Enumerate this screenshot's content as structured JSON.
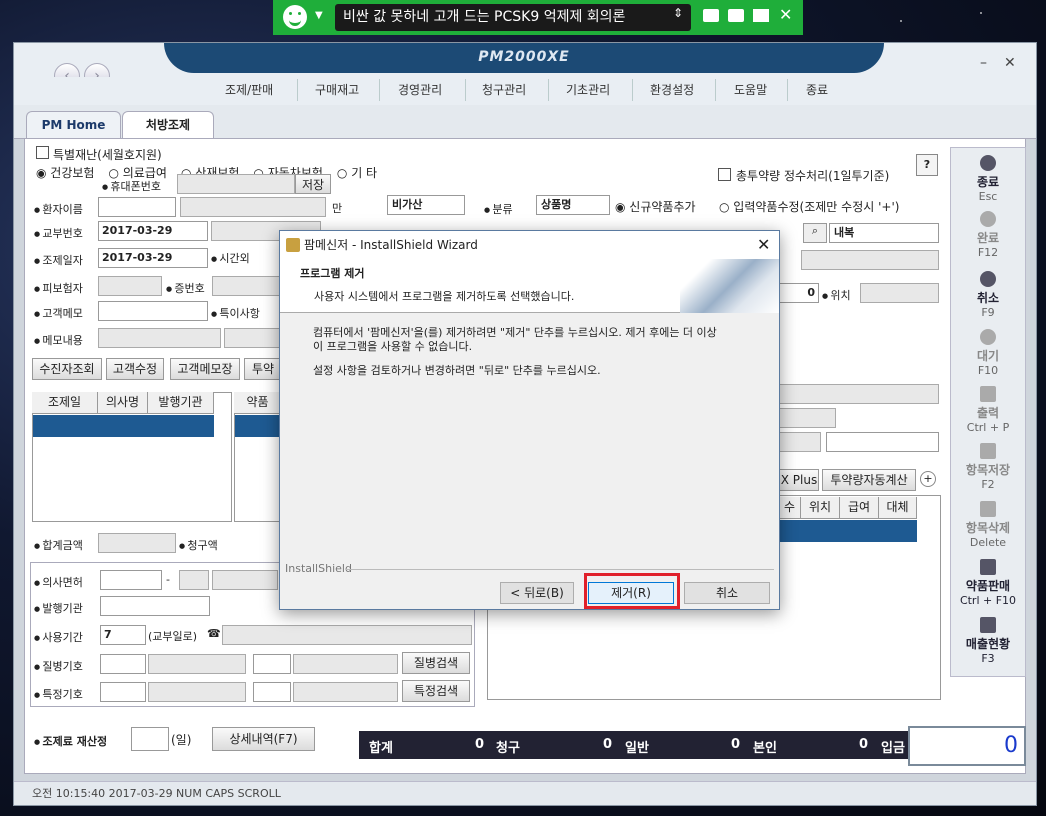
{
  "notification": {
    "headline": "비싼 값 못하네 고개 드는 PCSK9 억제제 회의론"
  },
  "window": {
    "brand": "PM2000XE",
    "menu": [
      "조제/판매",
      "구매재고",
      "경영관리",
      "청구관리",
      "기초관리",
      "환경설정",
      "도움말",
      "종료"
    ],
    "tabs": [
      "PM Home",
      "처방조제"
    ]
  },
  "form": {
    "special_disaster": "특별재난(세월호지원)",
    "insurance_options": [
      "건강보험",
      "의료급여",
      "산재보험",
      "자동차보험",
      "기    타"
    ],
    "daily_total_check": "총투약량 정수처리(1일투기준)",
    "help": "?",
    "phone_label": "휴대폰번호",
    "save_btn": "저장",
    "patient_name": "환자이름",
    "age_unit": "만",
    "nontax": "비가산",
    "issue_no": "교부번호",
    "issue_date": "2017-03-29",
    "dispense_date": "조제일자",
    "dispense_date_val": "2017-03-29",
    "time_label": "시간외",
    "insured": "피보험자",
    "cert_no": "증번호",
    "customer_memo": "고객메모",
    "special_note": "특이사항",
    "memo_content": "메모내용",
    "btn_lookup": "수진자조회",
    "btn_edit_customer": "고객수정",
    "btn_memo_customer": "고객메모장",
    "btn_med": "투약",
    "grid_headers": [
      "조제일",
      "의사명",
      "발행기관"
    ],
    "grid2_header": "약품",
    "sum_amount": "합계금액",
    "claim_amount": "청구액",
    "doctor_license": "의사면허",
    "issuer": "발행기관",
    "use_period": "사용기간",
    "use_period_val": "7",
    "from_issue": "(교부일로)",
    "disease_code": "질병기호",
    "btn_disease": "질병검색",
    "special_code": "특정기호",
    "btn_special": "특정검색",
    "class_label": "분류",
    "class_val": "상품명",
    "new_drug": "신규약품추가",
    "edit_drug": "입력약품수정(조제만 수정시 '+')",
    "internal": "내복",
    "qty_zero": "0",
    "position": "위치",
    "xplus": "X Plus",
    "auto_calc": "투약량자동계산",
    "drug_cols": [
      "수",
      "위치",
      "급여",
      "대체"
    ],
    "recalc_label": "조제료 재산정",
    "days_unit": "(일)",
    "detail_btn": "상세내역(F7)"
  },
  "sidebar": [
    {
      "label": "종료",
      "key": "Esc"
    },
    {
      "label": "완료",
      "key": "F12"
    },
    {
      "label": "취소",
      "key": "F9"
    },
    {
      "label": "대기",
      "key": "F10"
    },
    {
      "label": "출력",
      "key": "Ctrl + P"
    },
    {
      "label": "항목저장",
      "key": "F2"
    },
    {
      "label": "항목삭제",
      "key": "Delete"
    },
    {
      "label": "약품판매",
      "key": "Ctrl + F10"
    },
    {
      "label": "매출현황",
      "key": "F3"
    }
  ],
  "totals": {
    "sum": "합계",
    "sum_val": "0",
    "claim": "청구",
    "claim_val": "0",
    "general": "일반",
    "general_val": "0",
    "self": "본인",
    "self_val": "0",
    "paid": "입금",
    "paid_val": "0"
  },
  "status": {
    "text": "오전  10:15:40  2017-03-29    NUM    CAPS  SCROLL"
  },
  "dialog": {
    "title": "팜메신저 - InstallShield Wizard",
    "heading": "프로그램 제거",
    "subheading": "사용자 시스템에서 프로그램을 제거하도록 선택했습니다.",
    "body1": "컴퓨터에서 '팜메신저'을(를) 제거하려면 \"제거\" 단추를 누르십시오. 제거 후에는 더 이상",
    "body2": "이 프로그램을 사용할 수 없습니다.",
    "body3": "설정 사항을 검토하거나 변경하려면 \"뒤로\" 단추를 누르십시오.",
    "brand": "InstallShield",
    "back": "< 뒤로(B)",
    "remove": "제거(R)",
    "cancel": "취소"
  }
}
